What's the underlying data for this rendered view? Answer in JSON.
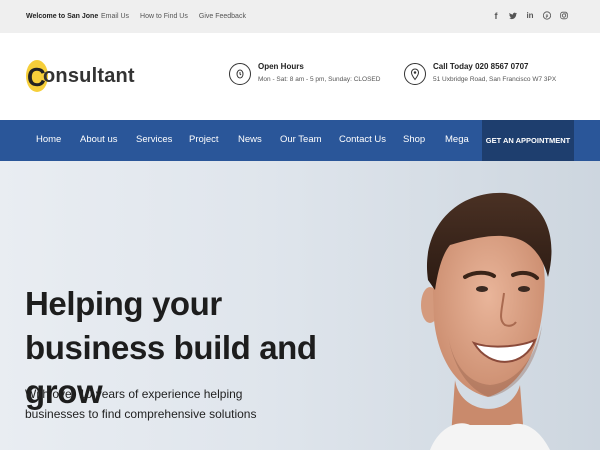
{
  "topbar": {
    "welcome": "Welcome to San Jone",
    "links": [
      "Email Us",
      "How to Find Us",
      "Give Feedback"
    ],
    "social": [
      {
        "name": "facebook-icon",
        "glyph": "f"
      },
      {
        "name": "twitter-icon",
        "glyph": "t"
      },
      {
        "name": "linkedin-icon",
        "glyph": "in"
      },
      {
        "name": "pinterest-icon",
        "glyph": "p"
      },
      {
        "name": "instagram-icon",
        "glyph": "◎"
      }
    ]
  },
  "header": {
    "logo_first": "C",
    "logo_rest": "onsultant",
    "hours": {
      "title": "Open Hours",
      "detail": "Mon - Sat: 8 am - 5 pm, Sunday: CLOSED",
      "icon": "clock-icon"
    },
    "call": {
      "title": "Call Today 020 8567 0707",
      "detail": "51 Uxbridge Road, San Francisco W7 3PX",
      "icon": "map-pin-icon"
    }
  },
  "nav": {
    "items": [
      "Home",
      "About us",
      "Services",
      "Project",
      "News",
      "Our Team",
      "Contact Us",
      "Shop",
      "Mega"
    ],
    "cta": "GET AN APPOINTMENT"
  },
  "hero": {
    "heading": "Helping your business build and grow",
    "subtext": "With over 10 years of experience helping businesses to find comprehensive solutions"
  },
  "colors": {
    "nav_bg": "#2a5699",
    "cta_bg": "#1e3e6e",
    "logo_accent": "#f6cf3a",
    "topbar_bg": "#efefef"
  }
}
